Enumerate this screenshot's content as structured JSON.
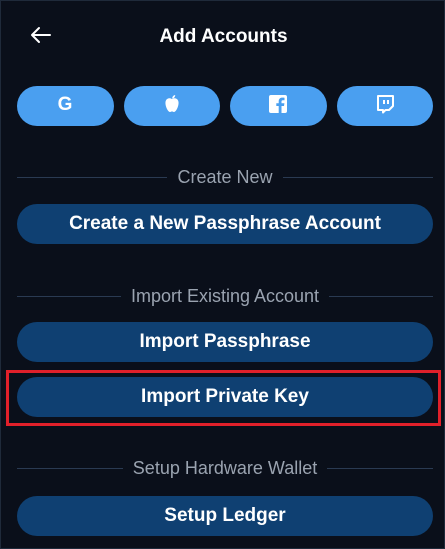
{
  "header": {
    "title": "Add Accounts",
    "back_icon": "arrow-left-icon"
  },
  "social": [
    {
      "name": "google",
      "icon": "google-icon",
      "glyph": "G"
    },
    {
      "name": "apple",
      "icon": "apple-icon"
    },
    {
      "name": "facebook",
      "icon": "facebook-icon",
      "glyph": "f"
    },
    {
      "name": "twitch",
      "icon": "twitch-icon"
    }
  ],
  "sections": {
    "create_new": {
      "label": "Create New",
      "button": "Create a New Passphrase Account"
    },
    "import_existing": {
      "label": "Import Existing Account",
      "import_passphrase": "Import Passphrase",
      "import_private_key": "Import Private Key"
    },
    "hardware": {
      "label": "Setup Hardware Wallet",
      "button": "Setup Ledger"
    }
  },
  "colors": {
    "background": "#0a0f1a",
    "social_button": "#4a9ff0",
    "primary_button": "#0f4072",
    "highlight": "#e0202a",
    "section_text": "#9aa3b0"
  }
}
